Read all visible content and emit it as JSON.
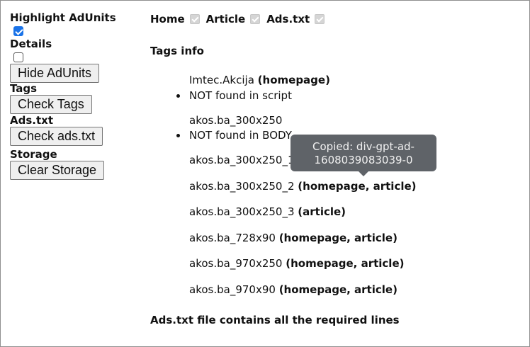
{
  "sidebar": {
    "highlight_label": "Highlight AdUnits",
    "highlight_checked": true,
    "details_label": "Details",
    "details_checked": false,
    "hide_button": "Hide AdUnits",
    "tags_label": "Tags",
    "check_tags_button": "Check Tags",
    "adstxt_label": "Ads.txt",
    "check_adstxt_button": "Check ads.txt",
    "storage_label": "Storage",
    "clear_storage_button": "Clear Storage"
  },
  "nav": {
    "home": "Home",
    "article": "Article",
    "adstxt": "Ads.txt"
  },
  "tags_info": {
    "title": "Tags info",
    "items": [
      {
        "name": "Imtec.Akcija",
        "pages": "(homepage)",
        "note": "NOT found in script"
      },
      {
        "name": "akos.ba_300x250",
        "pages": "",
        "note": "NOT found in BODY"
      },
      {
        "name": "akos.ba_300x250_1",
        "pages": "",
        "note": ""
      },
      {
        "name": "akos.ba_300x250_2",
        "pages": "(homepage, article)",
        "note": ""
      },
      {
        "name": "akos.ba_300x250_3",
        "pages": "(article)",
        "note": ""
      },
      {
        "name": "akos.ba_728x90",
        "pages": "(homepage, article)",
        "note": ""
      },
      {
        "name": "akos.ba_970x250",
        "pages": "(homepage, article)",
        "note": ""
      },
      {
        "name": "akos.ba_970x90",
        "pages": "(homepage, article)",
        "note": ""
      }
    ]
  },
  "adstxt_status": "Ads.txt file contains all the required lines",
  "tooltip": {
    "line1": "Copied: div-gpt-ad-",
    "line2": "1608039083039-0"
  }
}
